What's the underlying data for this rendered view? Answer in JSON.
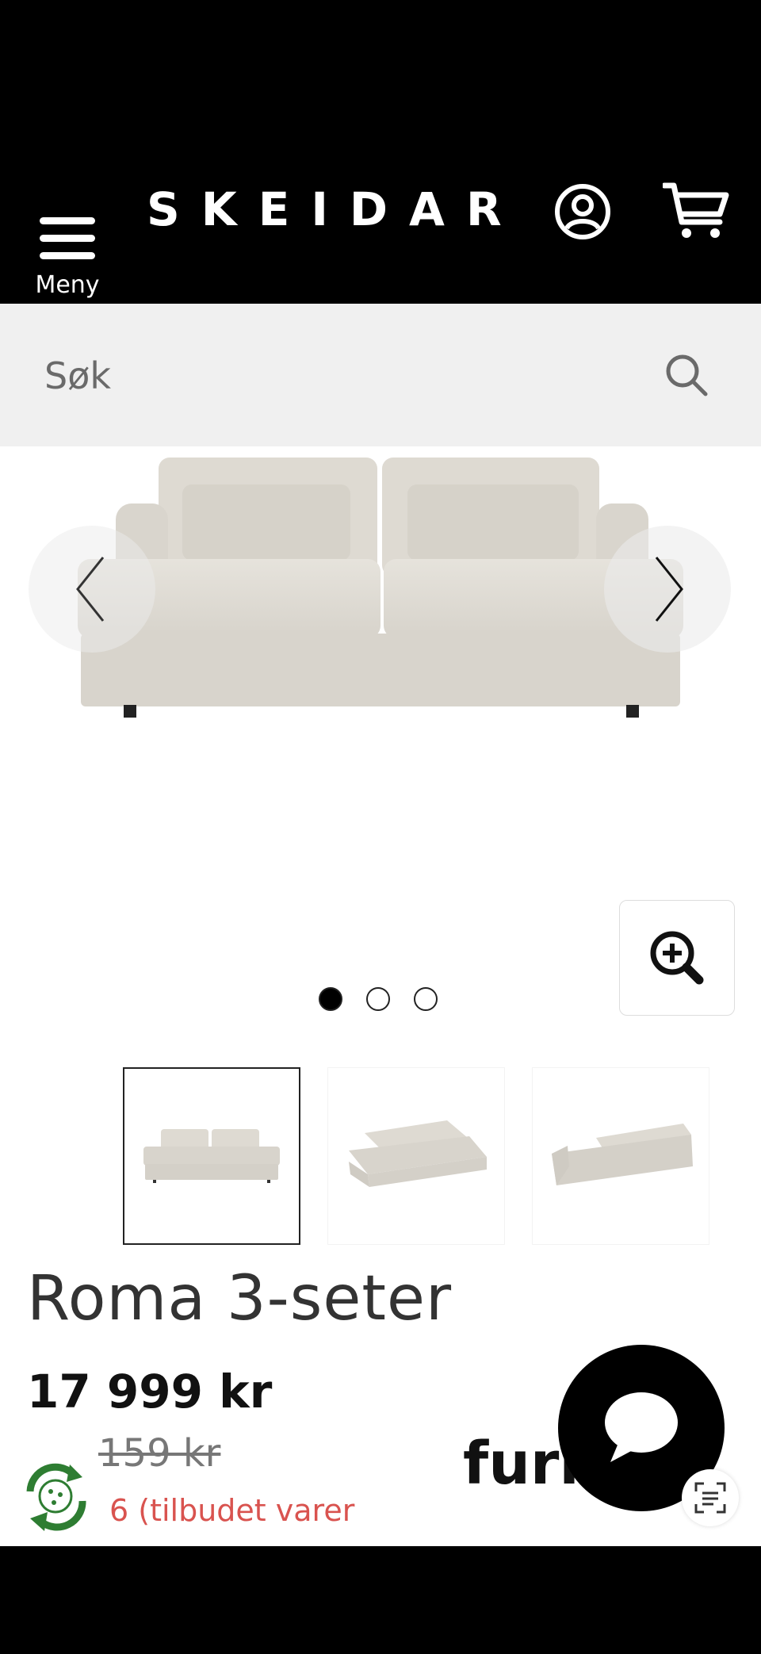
{
  "header": {
    "menu_label": "Meny",
    "logo": "SKEIDAR"
  },
  "search": {
    "placeholder": "Søk"
  },
  "gallery": {
    "active_index": 1,
    "total_images": 3
  },
  "product": {
    "title": "Roma 3-seter",
    "price": "17 999 kr",
    "old_price": "159 kr",
    "discount_text": "6 (tilbudet varer"
  },
  "brand_badge": "furn",
  "colors": {
    "header_bg": "#000000",
    "search_bg": "#f0f0f0",
    "discount": "#d9534f",
    "recycle_green": "#2e7d32"
  }
}
